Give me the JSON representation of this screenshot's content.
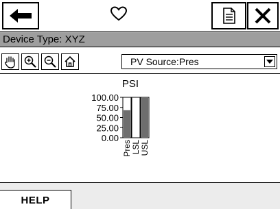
{
  "toolbar": {
    "back_icon": "left-arrow-icon",
    "favorite_icon": "heart-outline-icon",
    "document_icon": "document-icon",
    "close_icon": "close-x-icon"
  },
  "device": {
    "type_label": "Device Type: XYZ"
  },
  "tools": {
    "icons": [
      "pan-hand-icon",
      "zoom-in-icon",
      "zoom-out-icon",
      "home-icon"
    ],
    "pv_source": "PV Source:Pres"
  },
  "chart_data": {
    "type": "bar",
    "title": "PSI",
    "categories": [
      "Pres",
      "LSL",
      "USL"
    ],
    "values": [
      68,
      0,
      100
    ],
    "ylim": [
      0,
      100
    ],
    "yticks": [
      "100.00",
      "75.00",
      "50.00",
      "25.00",
      "0.00"
    ],
    "colors": {
      "fill": "#6e6e6e",
      "empty": "#ffffff"
    }
  },
  "footer": {
    "help_label": "HELP"
  },
  "colors": {
    "device_bar": "#9e9e9e",
    "bottom_bg": "#ececec"
  }
}
